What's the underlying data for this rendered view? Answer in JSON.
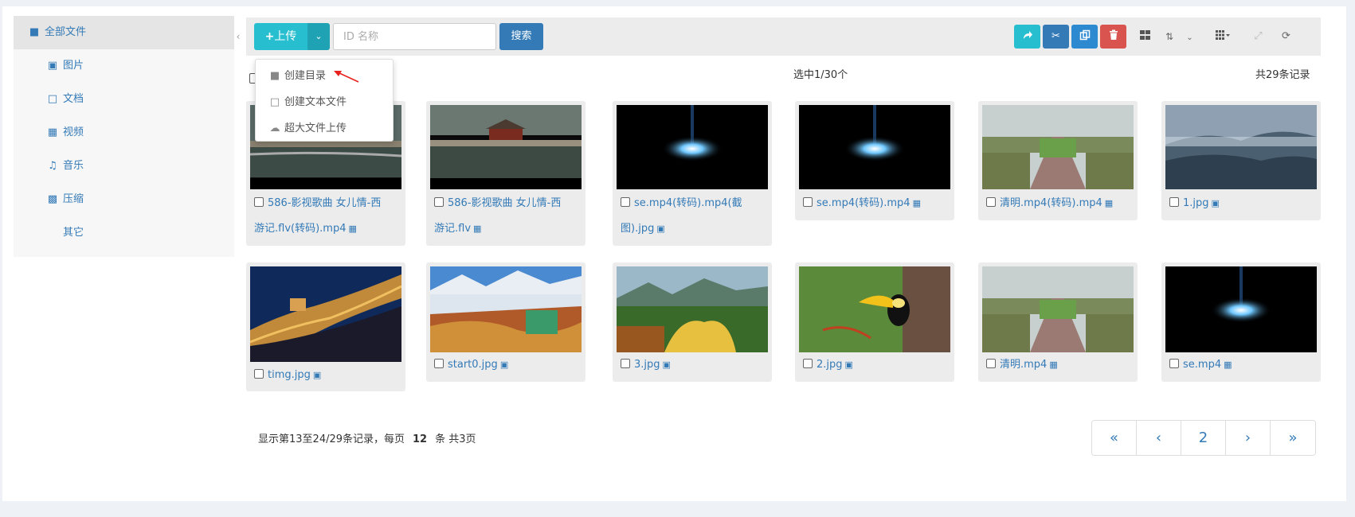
{
  "sidebar": {
    "items": [
      {
        "label": "全部文件",
        "icon": "folder-icon"
      },
      {
        "label": "图片",
        "icon": "image-icon"
      },
      {
        "label": "文档",
        "icon": "file-icon"
      },
      {
        "label": "视频",
        "icon": "film-icon"
      },
      {
        "label": "音乐",
        "icon": "music-icon"
      },
      {
        "label": "压缩",
        "icon": "archive-icon"
      },
      {
        "label": "其它",
        "icon": ""
      }
    ]
  },
  "toolbar": {
    "upload_label": "上传",
    "search_placeholder": "ID 名称",
    "search_value": "",
    "search_button": "搜索",
    "actions": [
      "share-icon",
      "cut-icon",
      "copy-icon",
      "delete-icon",
      "grid-view-icon",
      "sort-icon",
      "columns-icon",
      "fullscreen-icon",
      "refresh-icon"
    ],
    "colors": {
      "teal": "#27bfd0",
      "cut": "#337ab7",
      "copy": "#2e8ad0",
      "delete": "#d9534f"
    }
  },
  "upload_menu": {
    "items": [
      {
        "label": "创建目录",
        "icon": "folder-icon"
      },
      {
        "label": "创建文本文件",
        "icon": "file-icon"
      },
      {
        "label": "超大文件上传",
        "icon": "cloud-upload-icon"
      }
    ]
  },
  "status": {
    "selected": "选中1/30个",
    "total": "共29条记录"
  },
  "files": [
    {
      "line1": "586-影视歌曲 女儿情-西",
      "line2": "游记.flv(转码).mp4",
      "type": "video"
    },
    {
      "line1": "586-影视歌曲 女儿情-西",
      "line2": "游记.flv",
      "type": "video"
    },
    {
      "line1": "se.mp4(转码).mp4(截",
      "line2": "图).jpg",
      "type": "image"
    },
    {
      "line1": "se.mp4(转码).mp4",
      "line2": "",
      "type": "video"
    },
    {
      "line1": "清明.mp4(转码).mp4",
      "line2": "",
      "type": "video"
    },
    {
      "line1": "1.jpg",
      "line2": "",
      "type": "image"
    },
    {
      "line1": "timg.jpg",
      "line2": "",
      "type": "image"
    },
    {
      "line1": "start0.jpg",
      "line2": "",
      "type": "image"
    },
    {
      "line1": "3.jpg",
      "line2": "",
      "type": "image"
    },
    {
      "line1": "2.jpg",
      "line2": "",
      "type": "image"
    },
    {
      "line1": "清明.mp4",
      "line2": "",
      "type": "video"
    },
    {
      "line1": "se.mp4",
      "line2": "",
      "type": "video"
    }
  ],
  "paging": {
    "prefix": "显示第13至24/29条记录，每页",
    "per_page": "12",
    "suffix": "条 共3页",
    "buttons": [
      "«",
      "‹",
      "2",
      "›",
      "»"
    ]
  }
}
